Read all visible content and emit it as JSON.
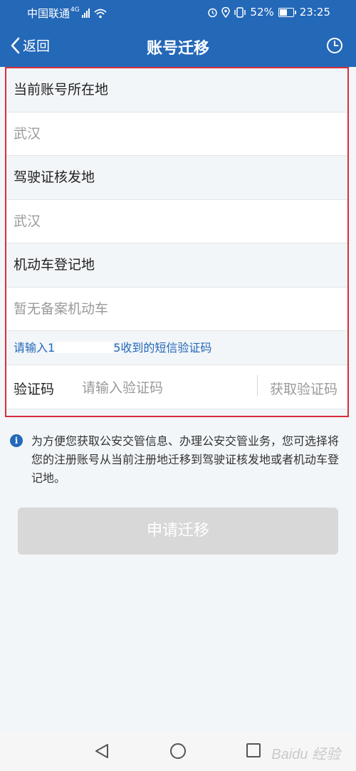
{
  "status_bar": {
    "carrier": "中国联通",
    "network": "4G",
    "battery": "52%",
    "time": "23:25"
  },
  "nav": {
    "back_label": "返回",
    "title": "账号迁移"
  },
  "form": {
    "current_location_label": "当前账号所在地",
    "current_location_value": "武汉",
    "license_issuer_label": "驾驶证核发地",
    "license_issuer_value": "武汉",
    "vehicle_reg_label": "机动车登记地",
    "vehicle_reg_value": "暂无备案机动车",
    "sms_hint_prefix": "请输入1",
    "sms_hint_suffix": "5收到的短信验证码",
    "code_label": "验证码",
    "code_placeholder": "请输入验证码",
    "get_code_label": "获取验证码"
  },
  "notice": {
    "text": "为方便您获取公安交管信息、办理公安交管业务，您可选择将您的注册账号从当前注册地迁移到驾驶证核发地或者机动车登记地。"
  },
  "apply_button": "申请迁移",
  "watermark": "Baidu 经验",
  "colors": {
    "header": "#2468b8",
    "highlight_border": "#d82e3a",
    "hint_text": "#2468b8",
    "disabled_button": "#d8d8d8"
  },
  "icons": [
    "back-chevron-icon",
    "history-clock-icon",
    "info-icon",
    "nav-back-icon",
    "nav-home-icon",
    "nav-recents-icon"
  ]
}
